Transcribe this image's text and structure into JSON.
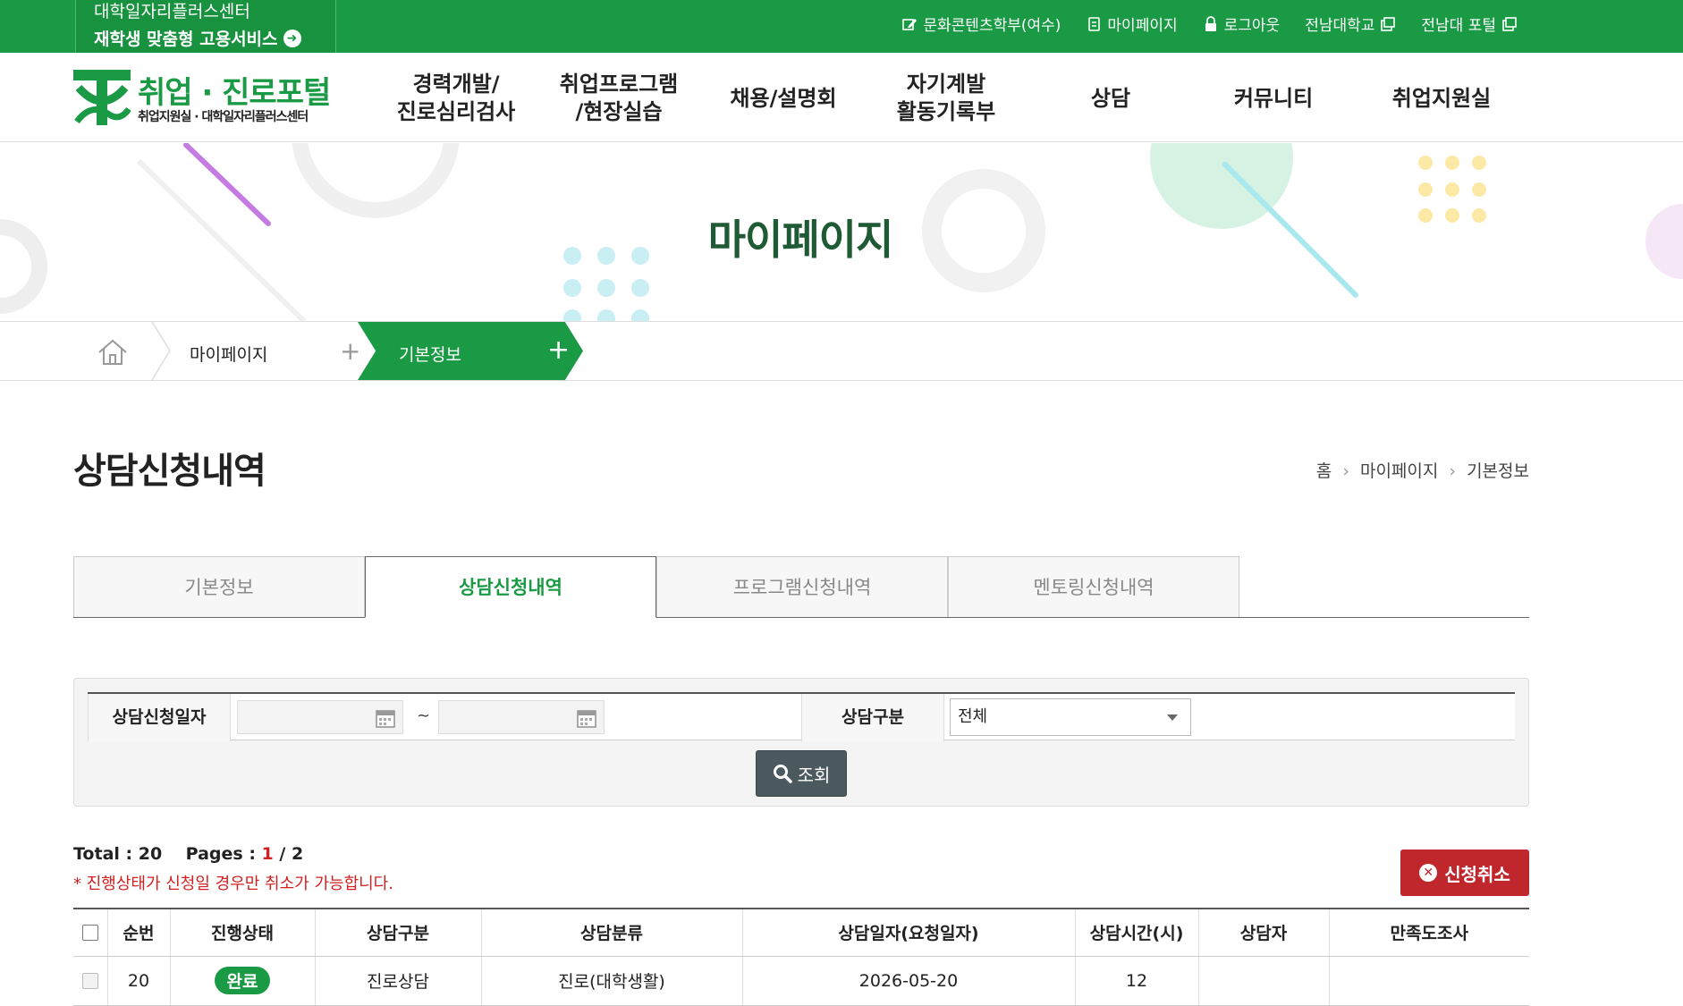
{
  "topbar": {
    "center_line1": "대학일자리플러스센터",
    "center_line2": "재학생 맞춤형 고용서비스",
    "links": [
      {
        "label": "문화콘텐츠학부(여수)",
        "icon": "edit-icon"
      },
      {
        "label": "마이페이지",
        "icon": "document-icon"
      },
      {
        "label": "로그아웃",
        "icon": "lock-icon"
      },
      {
        "label": "전남대학교",
        "icon": "new-window-icon"
      },
      {
        "label": "전남대 포털",
        "icon": "new-window-icon"
      }
    ]
  },
  "logo": {
    "title": "취업 · 진로포털",
    "subtitle": "취업지원실 · 대학일자리플러스센터"
  },
  "menu": [
    {
      "line1": "경력개발/",
      "line2": "진로심리검사"
    },
    {
      "line1": "취업프로그램",
      "line2": "/현장실습"
    },
    {
      "line1": "채용/설명회",
      "line2": ""
    },
    {
      "line1": "자기계발",
      "line2": "활동기록부"
    },
    {
      "line1": "상담",
      "line2": ""
    },
    {
      "line1": "커뮤니티",
      "line2": ""
    },
    {
      "line1": "취업지원실",
      "line2": ""
    }
  ],
  "banner": {
    "title": "마이페이지"
  },
  "location": {
    "level1": "마이페이지",
    "level2": "기본정보"
  },
  "page": {
    "title": "상담신청내역",
    "breadcrumb": [
      "홈",
      "마이페이지",
      "기본정보"
    ]
  },
  "tabs": [
    {
      "label": "기본정보",
      "active": false
    },
    {
      "label": "상담신청내역",
      "active": true
    },
    {
      "label": "프로그램신청내역",
      "active": false
    },
    {
      "label": "멘토링신청내역",
      "active": false
    }
  ],
  "search": {
    "date_label": "상담신청일자",
    "tilde": "~",
    "type_label": "상담구분",
    "type_value": "전체",
    "button_label": "조회"
  },
  "summary": {
    "total_label": "Total",
    "total_value": "20",
    "pages_label": "Pages",
    "page_current": "1",
    "page_total": "2",
    "notice": "* 진행상태가 신청일 경우만 취소가 가능합니다."
  },
  "cancel_button": "신청취소",
  "table": {
    "headers": [
      "순번",
      "진행상태",
      "상담구분",
      "상담분류",
      "상담일자(요청일자)",
      "상담시간(시)",
      "상담자",
      "만족도조사"
    ],
    "rows": [
      {
        "no": "20",
        "status": "완료",
        "type": "진로상담",
        "category": "진로(대학생활)",
        "date": "2026-05-20",
        "hour": "12",
        "counselor": "",
        "survey": ""
      }
    ]
  },
  "colors": {
    "brand": "#1b9a45",
    "cancel": "#c0272d",
    "notice": "#d21f1f"
  }
}
